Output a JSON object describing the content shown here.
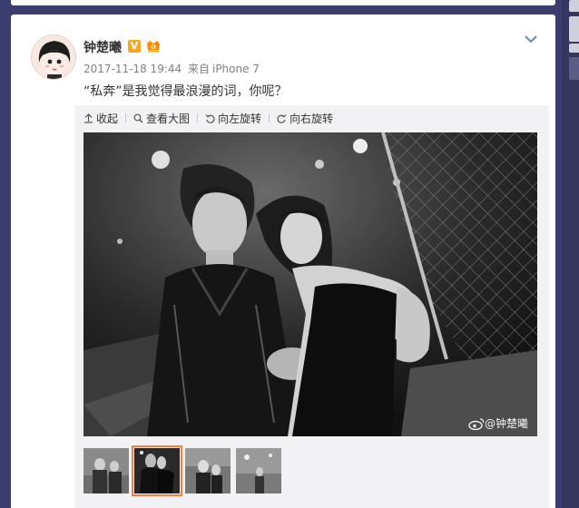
{
  "post": {
    "username": "钟楚曦",
    "verified_badge": "V",
    "timestamp": "2017-11-18 19:44",
    "source_prefix": "来自",
    "source_device": "iPhone 7",
    "text": "“私奔”是我觉得最浪漫的词，你呢？"
  },
  "toolbar": {
    "collapse_label": "收起",
    "view_large_label": "查看大图",
    "rotate_left_label": "向左旋转",
    "rotate_right_label": "向右旋转"
  },
  "photo": {
    "watermark": "@钟楚曦"
  },
  "thumbnails": [
    {
      "name": "thumb-1",
      "active": false
    },
    {
      "name": "thumb-2",
      "active": true
    },
    {
      "name": "thumb-3",
      "active": false
    },
    {
      "name": "thumb-4",
      "active": false
    }
  ],
  "colors": {
    "page_background": "#3b3d6e",
    "card": "#ffffff",
    "media_panel": "#f2f2f5",
    "active_thumb_outline": "#fa7d3c",
    "verified_badge": "#f6a623"
  },
  "icons": {
    "collapse": "arrow-up-icon",
    "view_large": "magnifier-icon",
    "rotate_left": "rotate-left-icon",
    "rotate_right": "rotate-right-icon",
    "menu": "chevron-down-icon",
    "watermark_logo": "weibo-logo-icon"
  }
}
